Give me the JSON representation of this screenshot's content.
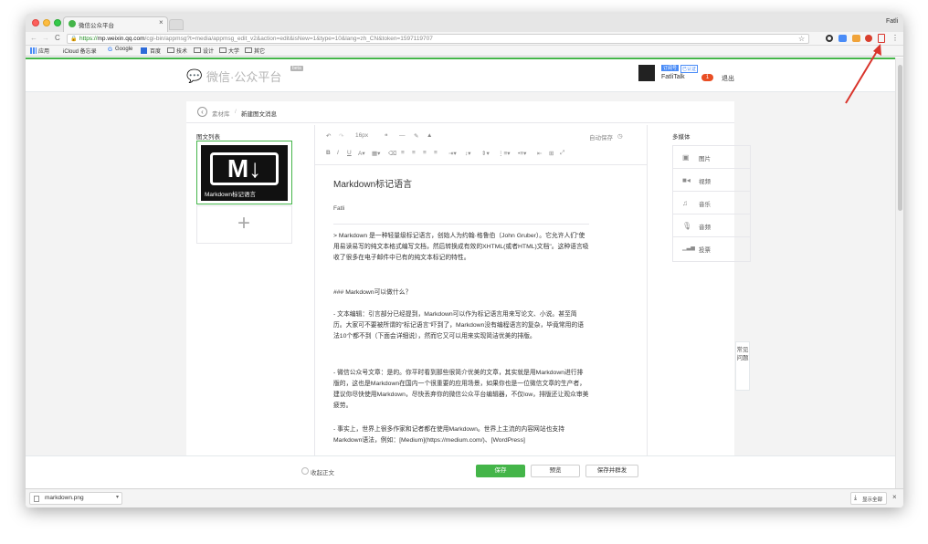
{
  "browser": {
    "tab_title": "微信公众平台",
    "tab_close": "×",
    "url_scheme": "https://",
    "url_host": "mp.weixin.qq.com",
    "url_path": "/cgi-bin/appmsg?t=media/appmsg_edit_v2&action=edit&isNew=1&type=10&lang=zh_CN&token=1597119707",
    "profile_name": "Fatli",
    "star": "☆",
    "menu_dots": "⋮",
    "nav_back": "←",
    "nav_forward": "→",
    "nav_reload": "C",
    "lock": "🔒",
    "bookmarks": [
      "应用",
      "iCloud 备忘录",
      "Google",
      "百度",
      "技术",
      "设计",
      "大学",
      "其它"
    ]
  },
  "site": {
    "logo_text": "微信·公众平台",
    "beta_badge": "beta",
    "account_badges": [
      "订阅号",
      "已认证"
    ],
    "account_name": "FatliTalk",
    "notification_count": "1",
    "logout": "退出"
  },
  "breadcrumb": {
    "back_icon": "‹",
    "parent": "素材库",
    "separator": "/",
    "current": "新建图文消息"
  },
  "article_list": {
    "title": "图文列表",
    "cover_logo": "M↓",
    "cover_caption": "Markdown标记语言",
    "add_icon": "+"
  },
  "editor": {
    "font_size": "16px",
    "autosave": "自动保存",
    "article_title": "Markdown标记语言",
    "author": "Fatli",
    "paragraphs": [
      "> Markdown 是一种轻量级标记语言，创始人为约翰·格鲁伯（John Gruber）。它允许人们\"使用易读易写的纯文本格式编写文档，然后转换成有效的XHTML(或者HTML)文档\"。这种语言吸收了很多在电子邮件中已有的纯文本标记的特性。",
      "### Markdown可以做什么？",
      "- 文本编辑：引言部分已经提到，Markdown可以作为标记语言用来写论文、小说。甚至简历。大家可不要被所谓的\"标记语言\"吓到了，Markdown没有编程语言的复杂，毕竟常用的语法10个都不到（下面会详细说），然而它又可以用来实现简洁优美的排版。",
      "- 微信公众号文章：是的。你平时看到那些很简介优美的文章，其实就是用Markdown进行排版的，这也是Markdown在国内一个很重要的应用场景，如果你也是一位微信文章的生产者，建议你尽快使用Markdown，尽快丢弃你的微信公众平台编辑器，不仅low，排版还让观众审美疲劳。",
      "- 事实上，世界上很多作家和记者都在使用Markdown。世界上主流的内容网站也支持Markdown语法，例如：[Medium](https://medium.com/)、[WordPress]"
    ]
  },
  "media": {
    "title": "多媒体",
    "items": [
      {
        "icon": "▣",
        "label": "图片"
      },
      {
        "icon": "■◂",
        "label": "视频"
      },
      {
        "icon": "♫",
        "label": "音乐"
      },
      {
        "icon": "🎙",
        "label": "音频"
      },
      {
        "icon": "▁▃▅",
        "label": "投票"
      }
    ]
  },
  "faq_tab": "常见问题",
  "footer": {
    "collapse": "收起正文",
    "save": "保存",
    "preview": "预览",
    "save_send": "保存并群发"
  },
  "downloads": {
    "file_name": "markdown.png",
    "show_all": "显示全部",
    "close": "×"
  },
  "colors": {
    "accent_green": "#44b549",
    "badge_red": "#e94e24",
    "arrow_red": "#d9342b"
  }
}
